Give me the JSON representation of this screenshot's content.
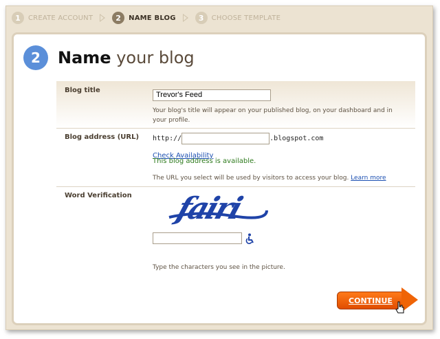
{
  "steps": [
    {
      "num": "1",
      "label": "CREATE ACCOUNT"
    },
    {
      "num": "2",
      "label": "NAME BLOG"
    },
    {
      "num": "3",
      "label": "CHOOSE TEMPLATE"
    }
  ],
  "heading": {
    "num": "2",
    "bold": "Name",
    "rest": "your blog"
  },
  "blog_title": {
    "label": "Blog title",
    "value": "Trevor's Feed",
    "help": "Your blog's title will appear on your published blog, on your dashboard and in your profile."
  },
  "blog_address": {
    "label": "Blog address (URL)",
    "prefix": "http://",
    "value": "",
    "suffix": ".blogspot.com",
    "check_link": "Check Availability",
    "status": "This blog address is available.",
    "help": "The URL you select will be used by visitors to access your blog.",
    "learn_more": "Learn more"
  },
  "word_verification": {
    "label": "Word Verification",
    "captcha_text": "fairi",
    "value": "",
    "help": "Type the characters you see in the picture."
  },
  "continue_label": "CONTINUE",
  "colors": {
    "accent_orange": "#ef6406",
    "step_blue": "#5b8fd9",
    "success_green": "#2d7a1c",
    "link_blue": "#1b4fb1"
  }
}
